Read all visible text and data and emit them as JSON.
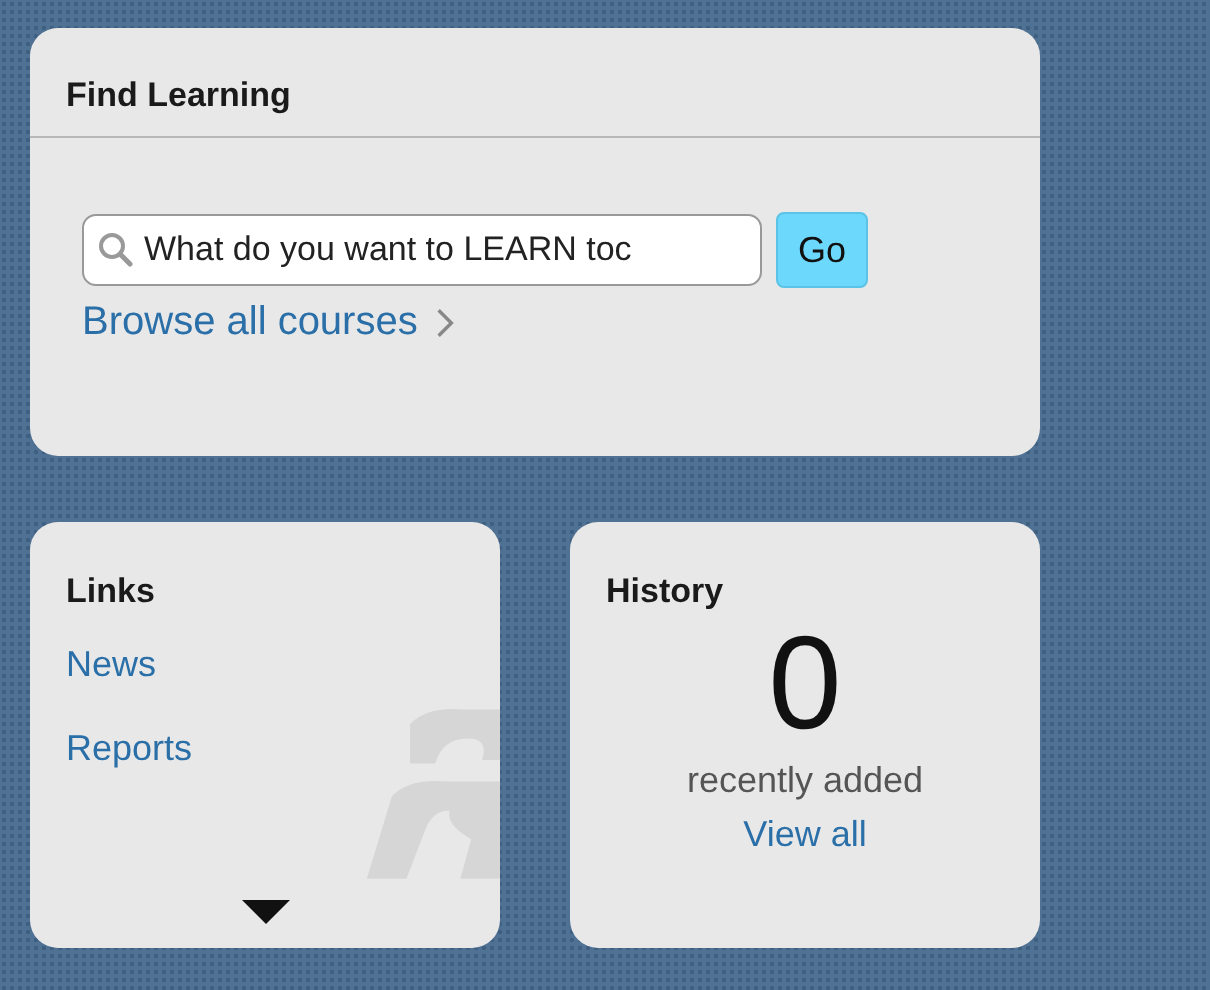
{
  "find_learning": {
    "title": "Find Learning",
    "search": {
      "value": "What do you want to LEARN toc"
    },
    "go_button": "Go",
    "browse_link": "Browse all courses"
  },
  "links": {
    "title": "Links",
    "items": [
      "News",
      "Reports"
    ]
  },
  "history": {
    "title": "History",
    "count": "0",
    "caption": "recently added",
    "link": "View all"
  }
}
